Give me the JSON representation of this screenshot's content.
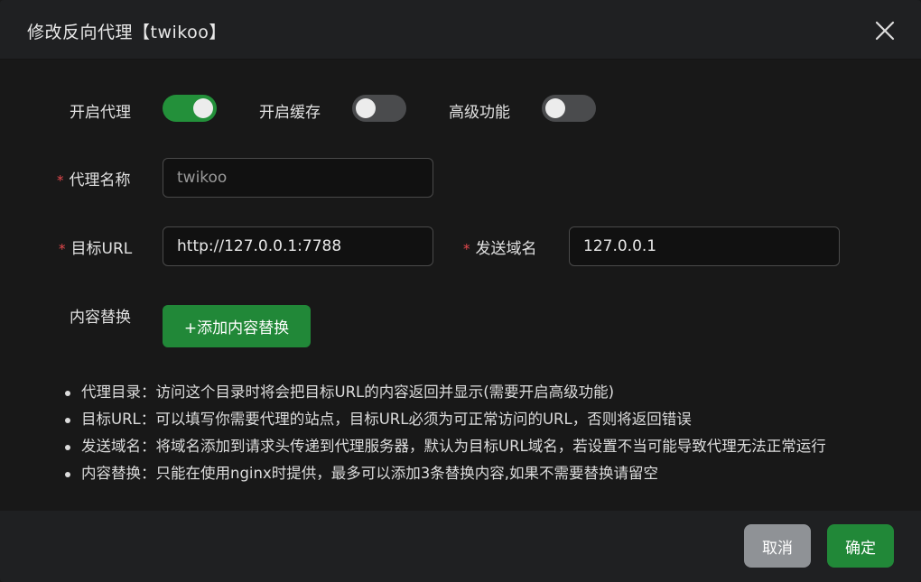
{
  "dialog": {
    "title": "修改反向代理【twikoo】"
  },
  "toggles": [
    {
      "label": "开启代理",
      "on": true
    },
    {
      "label": "开启缓存",
      "on": false
    },
    {
      "label": "高级功能",
      "on": false
    }
  ],
  "form": {
    "proxy_name": {
      "label": "代理名称",
      "required_mark": "*",
      "value": "twikoo"
    },
    "target_url": {
      "label": "目标URL",
      "required_mark": "*",
      "value": "http://127.0.0.1:7788"
    },
    "send_domain": {
      "label": "发送域名",
      "required_mark": "*",
      "value": "127.0.0.1"
    },
    "content_replace": {
      "label": "内容替换",
      "button_label": "+添加内容替换"
    }
  },
  "tips": [
    "代理目录：访问这个目录时将会把目标URL的内容返回并显示(需要开启高级功能)",
    "目标URL：可以填写你需要代理的站点，目标URL必须为可正常访问的URL，否则将返回错误",
    "发送域名：将域名添加到请求头传递到代理服务器，默认为目标URL域名，若设置不当可能导致代理无法正常运行",
    "内容替换：只能在使用nginx时提供，最多可以添加3条替换内容,如果不需要替换请留空"
  ],
  "footer": {
    "cancel_label": "取消",
    "confirm_label": "确定"
  },
  "icons": {
    "close": "close-icon"
  },
  "colors": {
    "accent": "#218838",
    "required": "#e5484d",
    "cancel": "#8f9296"
  }
}
